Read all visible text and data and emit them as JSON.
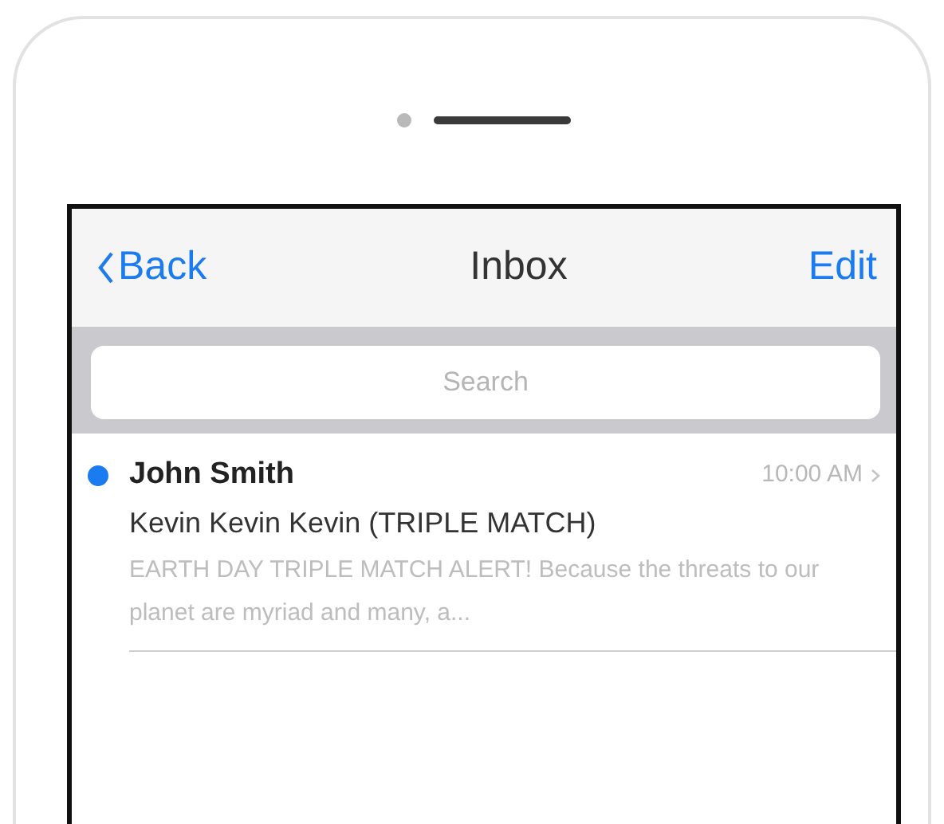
{
  "nav": {
    "back": "Back",
    "title": "Inbox",
    "edit": "Edit"
  },
  "search": {
    "placeholder": "Search"
  },
  "messages": [
    {
      "sender": "John Smith",
      "time": "10:00 AM",
      "unread": true,
      "subject": "Kevin Kevin Kevin (TRIPLE MATCH)",
      "preview": "EARTH DAY TRIPLE MATCH ALERT! Because the threats to our planet are myriad and many, a..."
    }
  ]
}
